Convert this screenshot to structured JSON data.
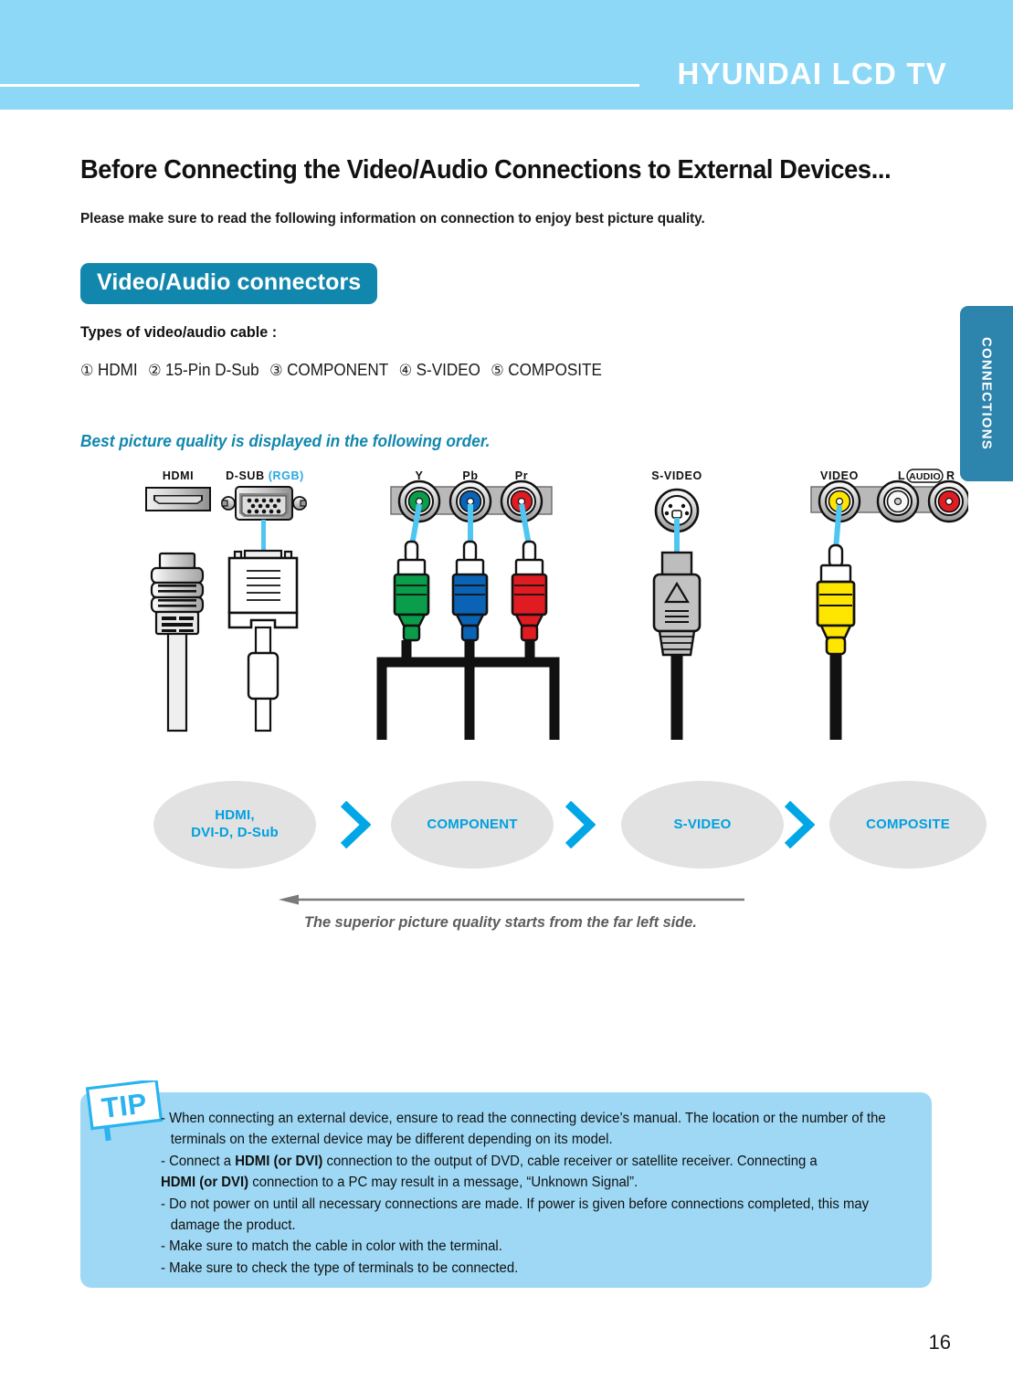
{
  "header": {
    "brand_title": "HYUNDAI LCD TV",
    "band_color": "#8ed8f7"
  },
  "side_tab": {
    "label": "CONNECTIONS",
    "color": "#2d84ad"
  },
  "page": {
    "title": "Before Connecting the Video/Audio Connections to External Devices...",
    "subtitle": "Please make sure to read the following information on connection to enjoy best picture quality.",
    "section_badge": "Video/Audio connectors",
    "types_heading": "Types of video/audio cable :",
    "types": [
      {
        "num": "①",
        "label": "HDMI"
      },
      {
        "num": "②",
        "label": "15-Pin D-Sub"
      },
      {
        "num": "③",
        "label": "COMPONENT"
      },
      {
        "num": "④",
        "label": "S-VIDEO"
      },
      {
        "num": "⑤",
        "label": "COMPOSITE"
      }
    ],
    "best_quality_note": "Best picture quality is displayed in the following order.",
    "arrow_note": "The superior picture quality starts from the far left side.",
    "page_number": "16",
    "accent_color": "#1287ae",
    "cyan_color": "#00a0e0"
  },
  "diagram": {
    "connectors": [
      {
        "name": "hdmi",
        "label": "HDMI",
        "label_suffix": ""
      },
      {
        "name": "d-sub",
        "label": "D-SUB ",
        "label_suffix": "(RGB)"
      },
      {
        "name": "component-y",
        "label": "Y",
        "label_suffix": ""
      },
      {
        "name": "component-pb",
        "label": "Pb",
        "label_suffix": ""
      },
      {
        "name": "component-pr",
        "label": "Pr",
        "label_suffix": ""
      },
      {
        "name": "s-video",
        "label": "S-VIDEO",
        "label_suffix": ""
      },
      {
        "name": "composite-video",
        "label": "VIDEO",
        "label_suffix": ""
      },
      {
        "name": "composite-audio-l",
        "label": "L",
        "label_suffix": ""
      },
      {
        "name": "composite-audio",
        "label": "AUDIO",
        "label_suffix": ""
      },
      {
        "name": "composite-audio-r",
        "label": "R",
        "label_suffix": ""
      }
    ]
  },
  "quality_order": {
    "ovals": [
      {
        "name": "hdmi-dvid-dsub",
        "line1": "HDMI,",
        "line2": "DVI-D, D-Sub"
      },
      {
        "name": "component",
        "line1": "COMPONENT",
        "line2": ""
      },
      {
        "name": "s-video",
        "line1": "S-VIDEO",
        "line2": ""
      },
      {
        "name": "composite",
        "line1": "COMPOSITE",
        "line2": ""
      }
    ],
    "separator_icon": "chevron-right-icon"
  },
  "tip": {
    "sign_label": "TIP",
    "items": [
      {
        "pre": "- When connecting an external device, ensure to read the connecting device’s manual. The location or the number of the terminals on the external device may be different depending on its model.",
        "bold": "",
        "post": ""
      },
      {
        "pre": "- Connect a ",
        "bold": "HDMI (or DVI)",
        "post": " connection to the output of DVD, cable receiver or satellite receiver. Connecting a "
      },
      {
        "pre": "",
        "bold": "HDMI (or DVI)",
        "post": " connection to a PC may result in a message, “Unknown Signal”."
      },
      {
        "pre": "- Do not power on until all necessary connections are made. If power is given before connections completed, this may damage the product.",
        "bold": "",
        "post": ""
      },
      {
        "pre": "- Make sure to match the cable in color with the terminal.",
        "bold": "",
        "post": ""
      },
      {
        "pre": "- Make sure to check the type of terminals to be connected.",
        "bold": "",
        "post": ""
      }
    ]
  }
}
